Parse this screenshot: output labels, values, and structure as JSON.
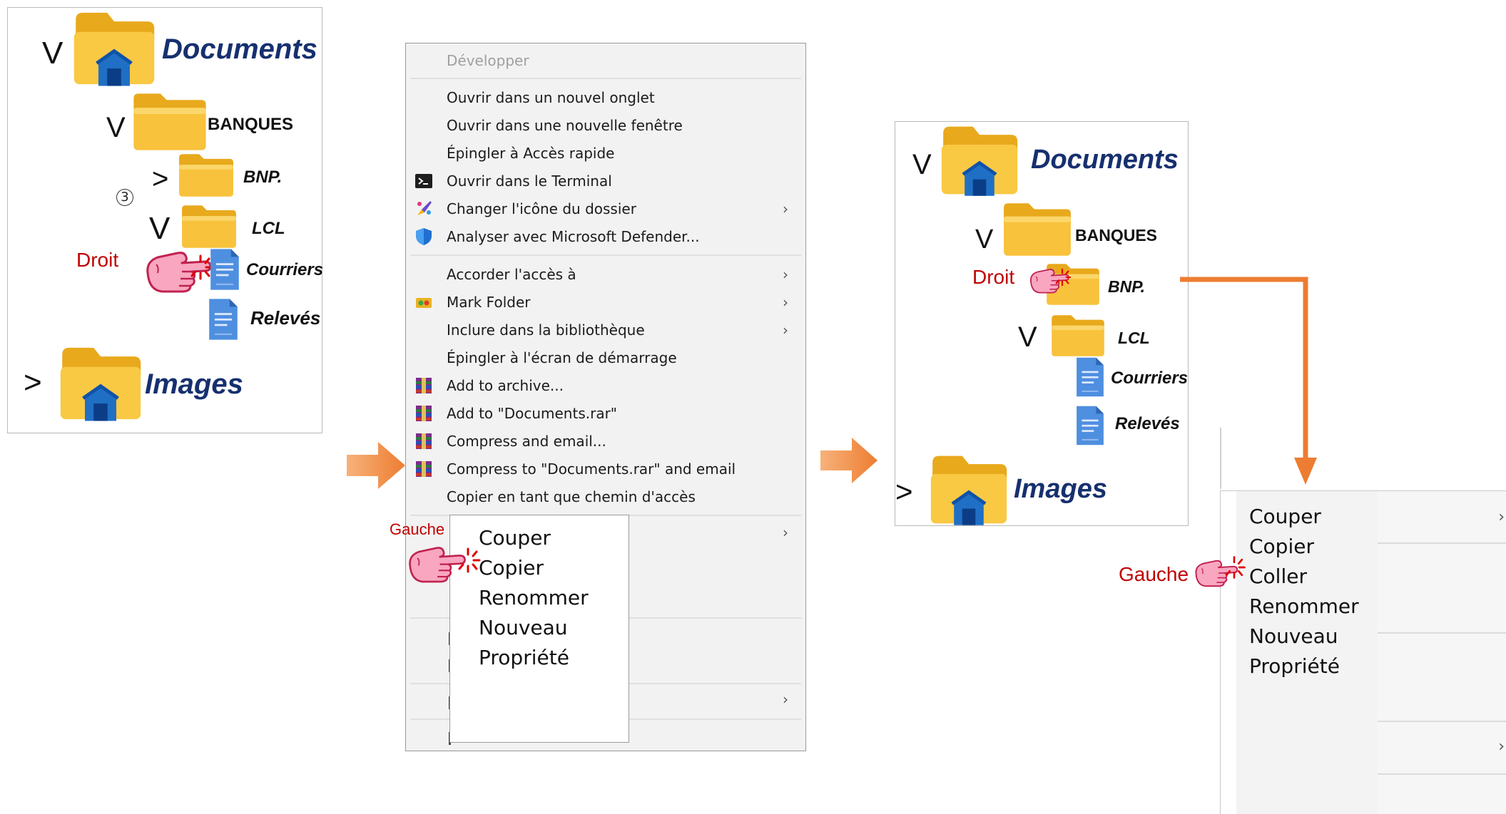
{
  "panel1": {
    "documents": "Documents",
    "banques": "BANQUES",
    "bnp": "BNP.",
    "step_marker": "3",
    "lcl": "LCL",
    "courriers": "Courriers",
    "releves": "Relevés",
    "images": "Images",
    "droit": "Droit",
    "caret_open": "V",
    "caret_closed": ">"
  },
  "context_menu": {
    "items": [
      {
        "label": "Développer",
        "disabled": true
      },
      {
        "label": "Ouvrir dans un nouvel onglet"
      },
      {
        "label": "Ouvrir dans une nouvelle fenêtre"
      },
      {
        "label": "Épingler à Accès rapide"
      },
      {
        "label": "Ouvrir dans le Terminal",
        "icon": "terminal-icon"
      },
      {
        "label": "Changer l'icône du dossier",
        "icon": "paint-icon",
        "submenu": true
      },
      {
        "label": "Analyser avec Microsoft Defender...",
        "icon": "defender-shield-icon"
      },
      {
        "label": "Accorder l'accès à",
        "submenu": true
      },
      {
        "label": "Mark Folder",
        "icon": "mark-folder-icon",
        "submenu": true
      },
      {
        "label": "Inclure dans la bibliothèque",
        "submenu": true
      },
      {
        "label": "Épingler à l'écran de démarrage"
      },
      {
        "label": "Add to archive...",
        "icon": "winrar-icon"
      },
      {
        "label": "Add to \"Documents.rar\"",
        "icon": "winrar-icon"
      },
      {
        "label": "Compress and email...",
        "icon": "winrar-icon"
      },
      {
        "label": "Compress to \"Documents.rar\" and email",
        "icon": "winrar-icon"
      },
      {
        "label": "Copier en tant que chemin d'accès"
      }
    ]
  },
  "submenu1": {
    "items": [
      "Couper",
      "Copier",
      "Renommer",
      "Nouveau",
      "Propriété"
    ],
    "gauche": "Gauche"
  },
  "panel2": {
    "documents": "Documents",
    "banques": "BANQUES",
    "bnp": "BNP.",
    "lcl": "LCL",
    "courriers": "Courriers",
    "releves": "Relevés",
    "images": "Images",
    "droit": "Droit"
  },
  "submenu2": {
    "items": [
      "Couper",
      "Copier",
      "Coller",
      "Renommer",
      "Nouveau",
      "Propriété"
    ],
    "gauche": "Gauche"
  },
  "colors": {
    "accent_orange": "#ed7d31",
    "title_blue": "#16306f",
    "red_label": "#c00000",
    "folder_yellow": "#f7c538"
  }
}
